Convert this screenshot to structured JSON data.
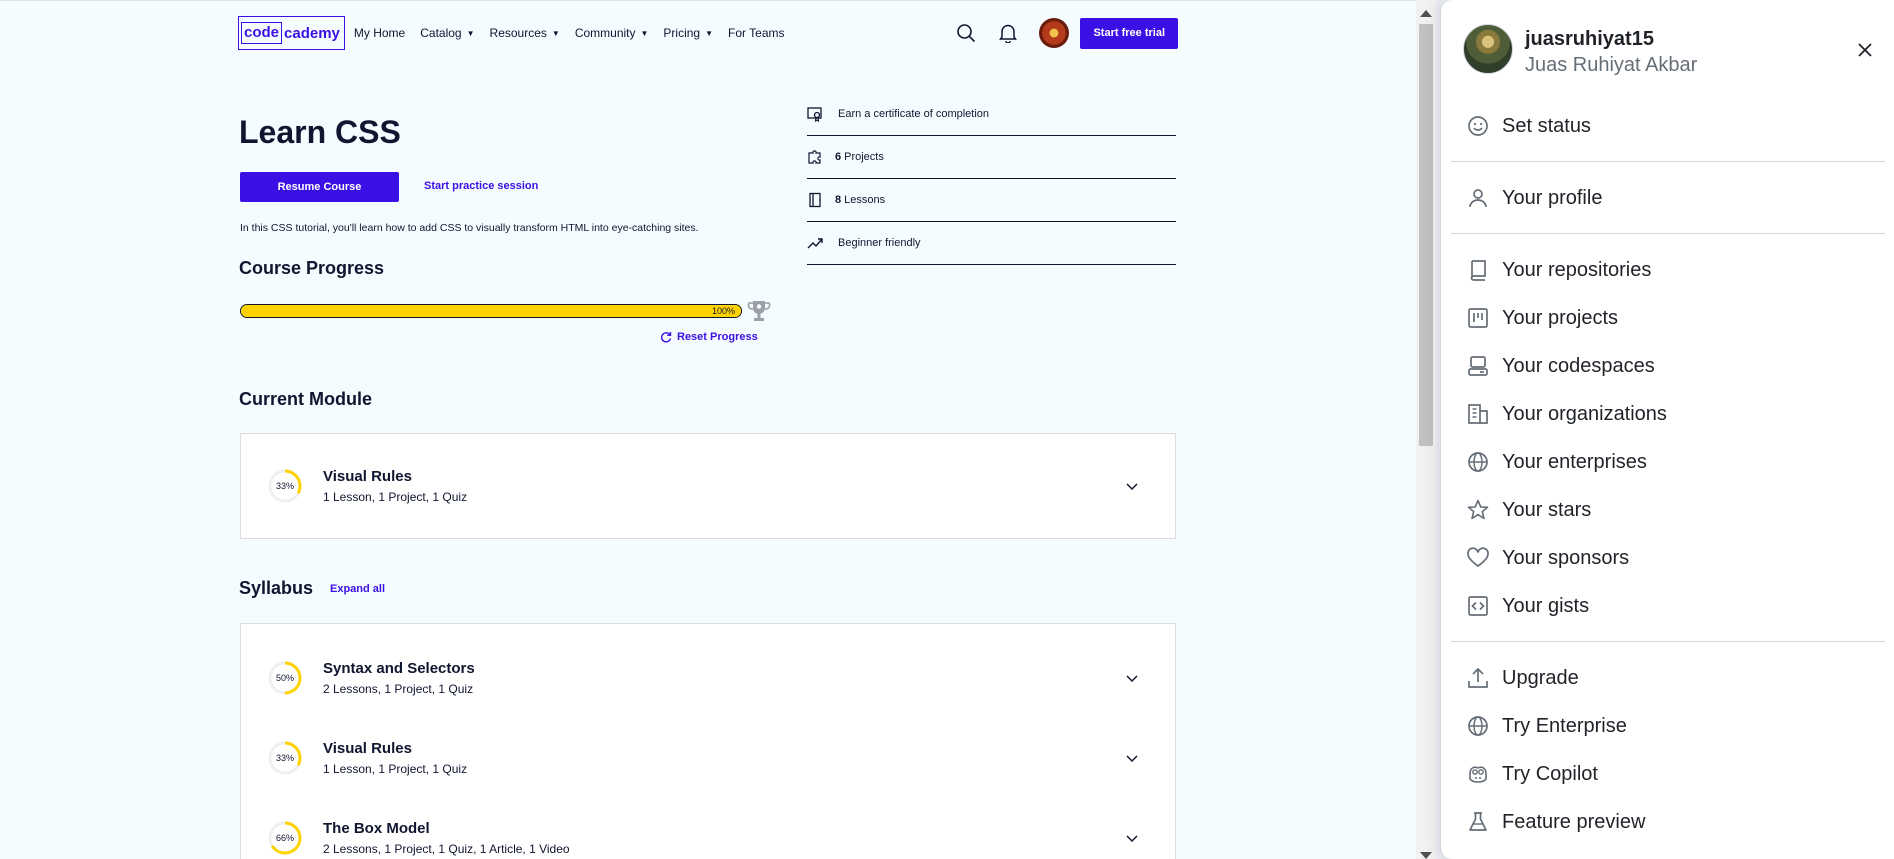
{
  "nav": {
    "logo_code": "code",
    "logo_cademy": "cademy",
    "links": [
      "My Home",
      "Catalog",
      "Resources",
      "Community",
      "Pricing",
      "For Teams"
    ],
    "trial_button": "Start free trial"
  },
  "course": {
    "title": "Learn CSS",
    "resume_button": "Resume Course",
    "practice_link": "Start practice session",
    "description": "In this CSS tutorial, you'll learn how to add CSS to visually transform HTML into eye-catching sites.",
    "progress_heading": "Course Progress",
    "progress_percent": 100,
    "progress_label": "100%",
    "reset_link": "Reset Progress"
  },
  "features": [
    {
      "icon": "certificate-icon",
      "bold": "",
      "text": "Earn a certificate of completion"
    },
    {
      "icon": "puzzle-icon",
      "bold": "6",
      "text": "Projects"
    },
    {
      "icon": "book-icon",
      "bold": "8",
      "text": "Lessons"
    },
    {
      "icon": "trend-up-icon",
      "bold": "",
      "text": "Beginner friendly"
    }
  ],
  "current_module": {
    "heading": "Current Module",
    "title": "Visual Rules",
    "subtitle": "1 Lesson, 1 Project, 1 Quiz",
    "percent": 33,
    "percent_label": "33%"
  },
  "syllabus": {
    "heading": "Syllabus",
    "expand_all": "Expand all",
    "modules": [
      {
        "title": "Syntax and Selectors",
        "subtitle": "2 Lessons, 1 Project, 1 Quiz",
        "percent": 50,
        "percent_label": "50%"
      },
      {
        "title": "Visual Rules",
        "subtitle": "1 Lesson, 1 Project, 1 Quiz",
        "percent": 33,
        "percent_label": "33%"
      },
      {
        "title": "The Box Model",
        "subtitle": "2 Lessons, 1 Project, 1 Quiz, 1 Article, 1 Video",
        "percent": 66,
        "percent_label": "66%"
      }
    ]
  },
  "user_menu": {
    "login": "juasruhiyat15",
    "full_name": "Juas Ruhiyat Akbar",
    "groups": [
      [
        {
          "label": "Set status",
          "icon": "smiley-icon"
        }
      ],
      [
        {
          "label": "Your profile",
          "icon": "person-icon"
        }
      ],
      [
        {
          "label": "Your repositories",
          "icon": "repo-icon"
        },
        {
          "label": "Your projects",
          "icon": "project-board-icon"
        },
        {
          "label": "Your codespaces",
          "icon": "codespaces-icon"
        },
        {
          "label": "Your organizations",
          "icon": "organization-icon"
        },
        {
          "label": "Your enterprises",
          "icon": "globe-icon"
        },
        {
          "label": "Your stars",
          "icon": "star-icon"
        },
        {
          "label": "Your sponsors",
          "icon": "heart-icon"
        },
        {
          "label": "Your gists",
          "icon": "code-square-icon"
        }
      ],
      [
        {
          "label": "Upgrade",
          "icon": "upload-icon"
        },
        {
          "label": "Try Enterprise",
          "icon": "globe-icon"
        },
        {
          "label": "Try Copilot",
          "icon": "copilot-icon"
        },
        {
          "label": "Feature preview",
          "icon": "beaker-icon"
        }
      ]
    ]
  },
  "colors": {
    "brand": "#3a10e5",
    "progress": "#ffd300",
    "text": "#10162f",
    "page_bg": "#f5fcff"
  }
}
